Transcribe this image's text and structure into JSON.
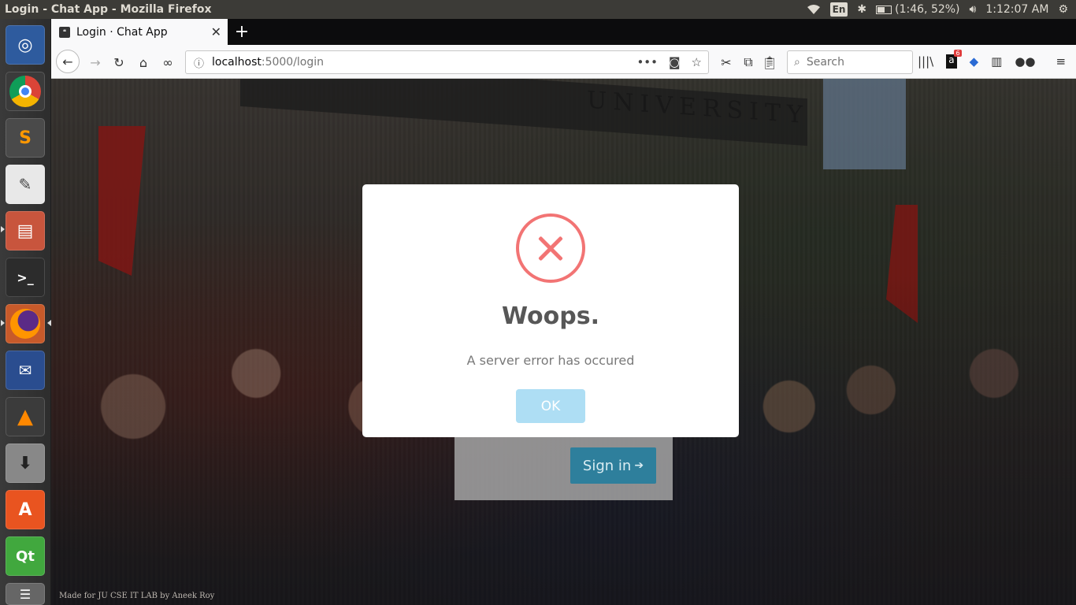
{
  "window": {
    "title": "Login - Chat App - Mozilla Firefox"
  },
  "panel": {
    "lang": "En",
    "battery": "(1:46, 52%)",
    "clock": "1:12:07 AM"
  },
  "browser": {
    "tab_title": "Login · Chat App",
    "url_host": "localhost",
    "url_path": ":5000/login",
    "search_placeholder": "Search",
    "badge_count": "6"
  },
  "page": {
    "banner_text": "UNIVERSITY",
    "signin_label": "Sign in",
    "footer": "Made for JU CSE IT LAB by Aneek Roy"
  },
  "modal": {
    "title": "Woops.",
    "text": "A server error has occured",
    "ok_label": "OK",
    "accent_color": "#f27474",
    "button_color": "#aedef4"
  },
  "launcher": {
    "items": [
      "ubuntu-dash",
      "chrome",
      "sublime-text",
      "text-editor",
      "files",
      "terminal",
      "firefox",
      "mail",
      "vlc",
      "installer",
      "software-center",
      "qt-creator",
      "stack"
    ]
  }
}
